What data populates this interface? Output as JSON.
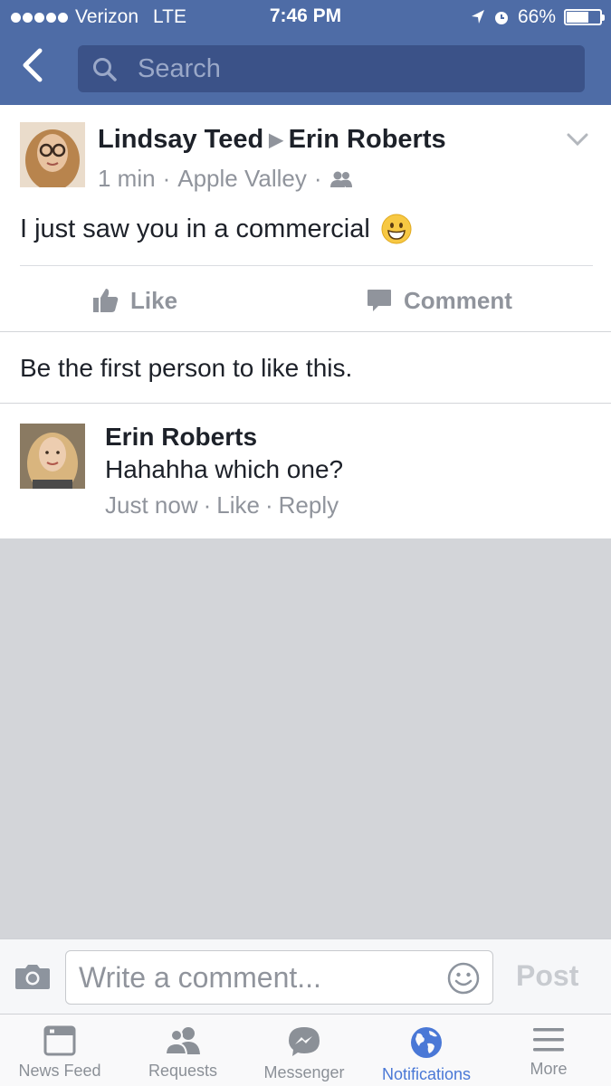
{
  "status_bar": {
    "carrier": "Verizon",
    "network": "LTE",
    "time": "7:46 PM",
    "battery": "66%",
    "battery_level": 0.66
  },
  "header": {
    "back_icon": "chevron-left-icon",
    "search_placeholder": "Search"
  },
  "post": {
    "author": "Lindsay Teed",
    "recipient": "Erin Roberts",
    "time": "1 min",
    "location": "Apple Valley",
    "privacy_icon": "friends-icon",
    "text": "I just saw you in a commercial",
    "emoji_icon": "grinning-face-icon",
    "like_label": "Like",
    "comment_label": "Comment"
  },
  "likes_summary": "Be the first person to like this.",
  "comment": {
    "author": "Erin Roberts",
    "text": "Hahahha which one?",
    "time": "Just now",
    "like_label": "Like",
    "reply_label": "Reply"
  },
  "composer": {
    "placeholder": "Write a comment...",
    "post_label": "Post"
  },
  "tabs": [
    {
      "label": "News Feed",
      "icon": "news-feed-icon"
    },
    {
      "label": "Requests",
      "icon": "friend-requests-icon"
    },
    {
      "label": "Messenger",
      "icon": "messenger-icon"
    },
    {
      "label": "Notifications",
      "icon": "globe-icon",
      "active": true
    },
    {
      "label": "More",
      "icon": "menu-icon"
    }
  ],
  "colors": {
    "brand": "#4e6ca6",
    "active_tab": "#4a78d6",
    "muted_text": "#90949c"
  }
}
